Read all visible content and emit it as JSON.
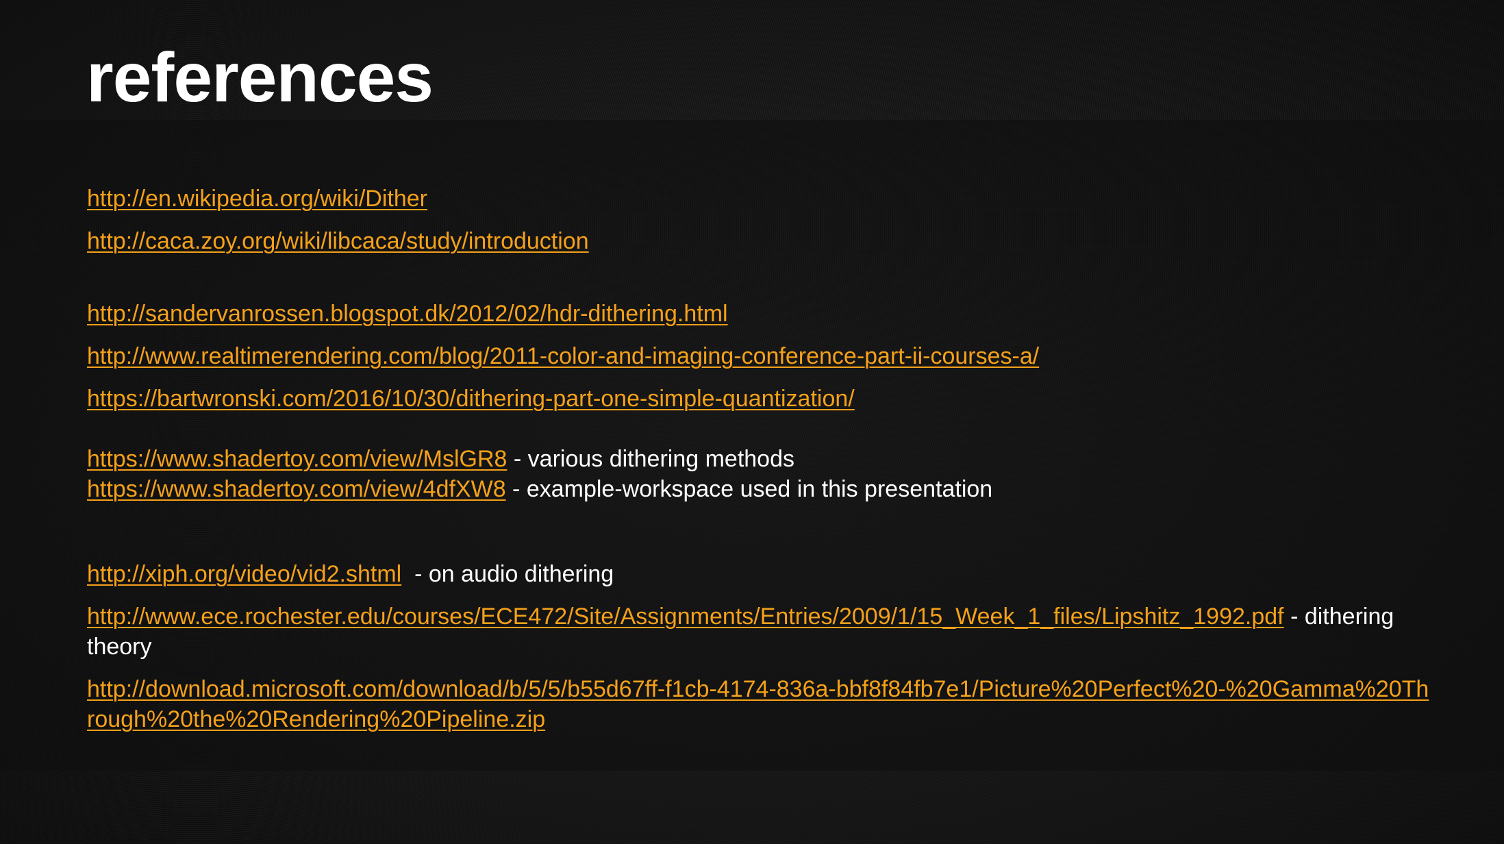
{
  "slide": {
    "title": "references",
    "colors": {
      "link": "#f5a11a",
      "text": "#ffffff",
      "background": "#1a1a1a"
    }
  },
  "refs": {
    "r1": {
      "url": "http://en.wikipedia.org/wiki/Dither"
    },
    "r2": {
      "url": "http://caca.zoy.org/wiki/libcaca/study/introduction"
    },
    "r3": {
      "url": "http://sandervanrossen.blogspot.dk/2012/02/hdr-dithering.html"
    },
    "r4": {
      "url": "http://www.realtimerendering.com/blog/2011-color-and-imaging-conference-part-ii-courses-a/"
    },
    "r5": {
      "url": "https://bartwronski.com/2016/10/30/dithering-part-one-simple-quantization/"
    },
    "r6": {
      "url": "https://www.shadertoy.com/view/MslGR8",
      "desc": " - various dithering methods"
    },
    "r7": {
      "url": "https://www.shadertoy.com/view/4dfXW8",
      "desc": " - example-workspace used in this presentation"
    },
    "r8": {
      "url": "http://xiph.org/video/vid2.shtml",
      "desc": "  - on audio dithering"
    },
    "r9": {
      "url": "http://www.ece.rochester.edu/courses/ECE472/Site/Assignments/Entries/2009/1/15_Week_1_files/Lipshitz_1992.pdf",
      "desc": " - dithering theory"
    },
    "r10": {
      "url": "http://download.microsoft.com/download/b/5/5/b55d67ff-f1cb-4174-836a-bbf8f84fb7e1/Picture%20Perfect%20-%20Gamma%20Through%20the%20Rendering%20Pipeline.zip"
    }
  }
}
